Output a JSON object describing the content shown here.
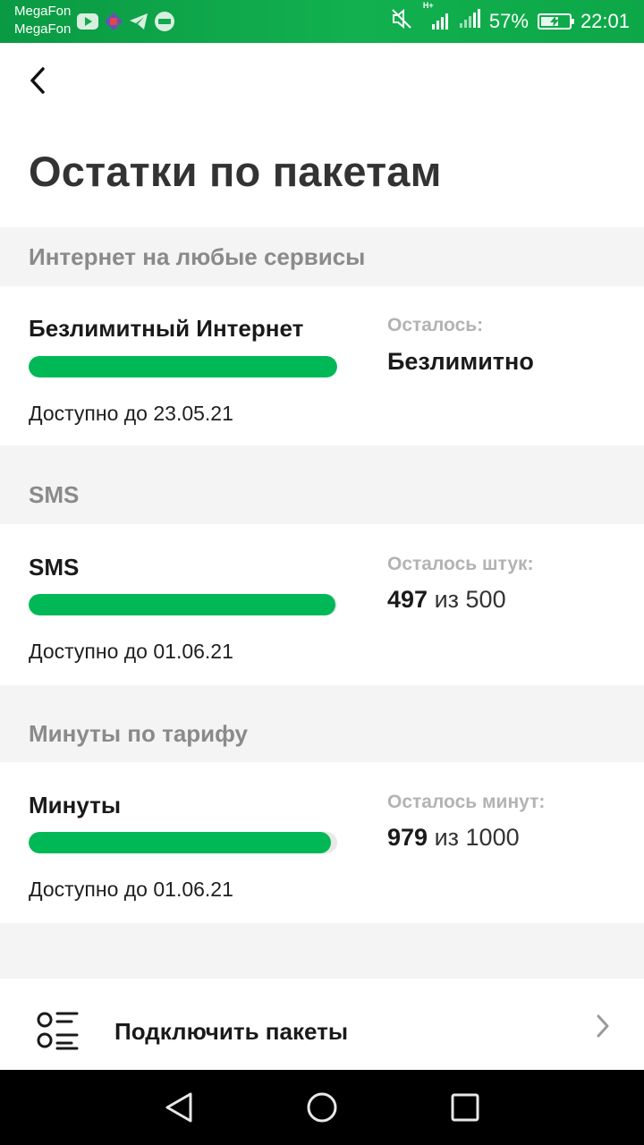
{
  "status_bar": {
    "carrier_1": "MegaFon",
    "carrier_2": "MegaFon",
    "network": "H+",
    "battery": "57%",
    "time": "22:01"
  },
  "header": {
    "title": "Остатки по пакетам"
  },
  "sections": [
    {
      "title": "Интернет на любые сервисы",
      "package": {
        "name": "Безлимитный Интернет",
        "available_until": "Доступно до 23.05.21",
        "remaining_label": "Осталось:",
        "remaining_value": "Безлимитно",
        "progress": 1.0
      }
    },
    {
      "title": "SMS",
      "package": {
        "name": "SMS",
        "available_until": "Доступно до 01.06.21",
        "remaining_label": "Осталось штук:",
        "remaining_amount": "497",
        "remaining_of": "из 500",
        "progress": 0.994
      }
    },
    {
      "title": "Минуты по тарифу",
      "package": {
        "name": "Минуты",
        "available_until": "Доступно до 01.06.21",
        "remaining_label": "Осталось минут:",
        "remaining_amount": "979",
        "remaining_of": "из 1000",
        "progress": 0.979
      }
    }
  ],
  "connect": {
    "label": "Подключить пакеты",
    "icon": "list-icon"
  },
  "colors": {
    "accent": "#00b956",
    "status_bar": "#0fa84a",
    "section_label": "#8a8a8a",
    "remaining_label": "#b3b3b3"
  }
}
